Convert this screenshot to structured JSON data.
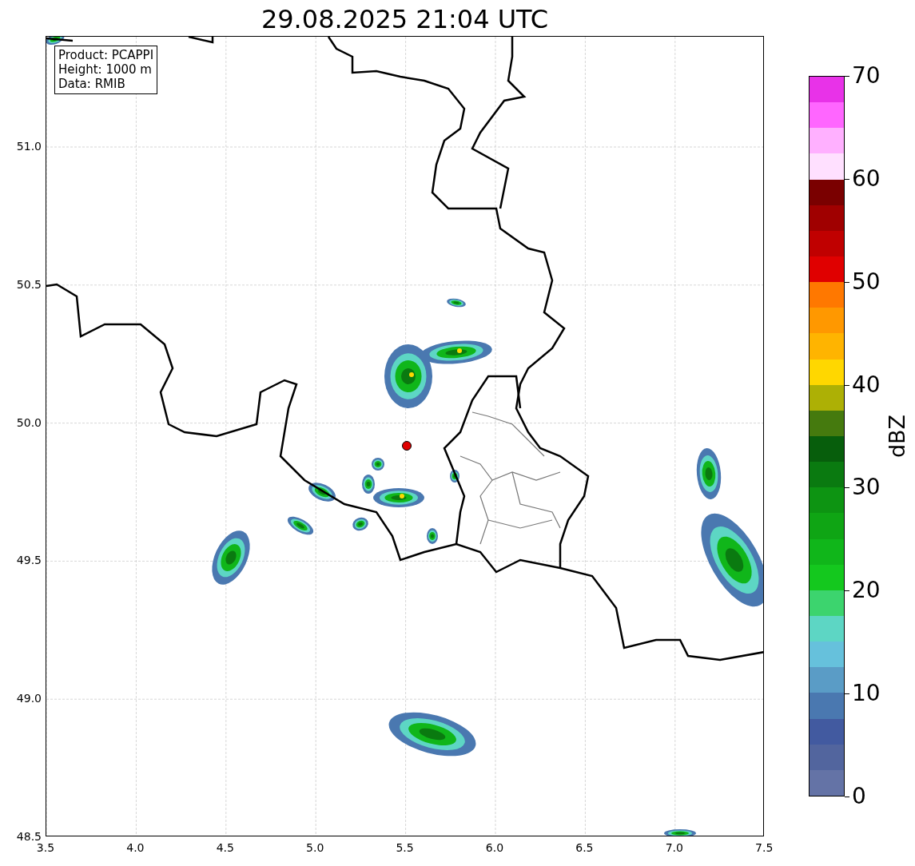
{
  "title": "29.08.2025 21:04 UTC",
  "info_box": [
    "Product: PCAPPI",
    "Height: 1000 m",
    "Data: RMIB"
  ],
  "map": {
    "xticks": [
      "3.5",
      "4.0",
      "4.5",
      "5.0",
      "5.5",
      "6.0",
      "6.5",
      "7.0",
      "7.5"
    ],
    "yticks": [
      "51.0",
      "50.5",
      "50.0",
      "49.5",
      "49.0",
      "48.5"
    ]
  },
  "colorbar": {
    "label": "dBZ",
    "ticks": [
      "70",
      "60",
      "50",
      "40",
      "30",
      "20",
      "10",
      "0"
    ],
    "bands": [
      {
        "color": "#6473a6"
      },
      {
        "color": "#52659e"
      },
      {
        "color": "#425aa0"
      },
      {
        "color": "#4a78b0"
      },
      {
        "color": "#5a9cc6"
      },
      {
        "color": "#66c1dc"
      },
      {
        "color": "#5dd6c4"
      },
      {
        "color": "#3cd46e"
      },
      {
        "color": "#14c81e"
      },
      {
        "color": "#10b61a"
      },
      {
        "color": "#0fa514"
      },
      {
        "color": "#0d9412"
      },
      {
        "color": "#0a7a10"
      },
      {
        "color": "#075e0c"
      },
      {
        "color": "#457a0e"
      },
      {
        "color": "#adb005"
      },
      {
        "color": "#ffd700"
      },
      {
        "color": "#ffb400"
      },
      {
        "color": "#ff9800"
      },
      {
        "color": "#ff7800"
      },
      {
        "color": "#e00000"
      },
      {
        "color": "#c00000"
      },
      {
        "color": "#a00000"
      },
      {
        "color": "#7a0000"
      },
      {
        "color": "#ffe0ff"
      },
      {
        "color": "#ffb0ff"
      },
      {
        "color": "#ff66ff"
      },
      {
        "color": "#e832e8"
      }
    ]
  }
}
